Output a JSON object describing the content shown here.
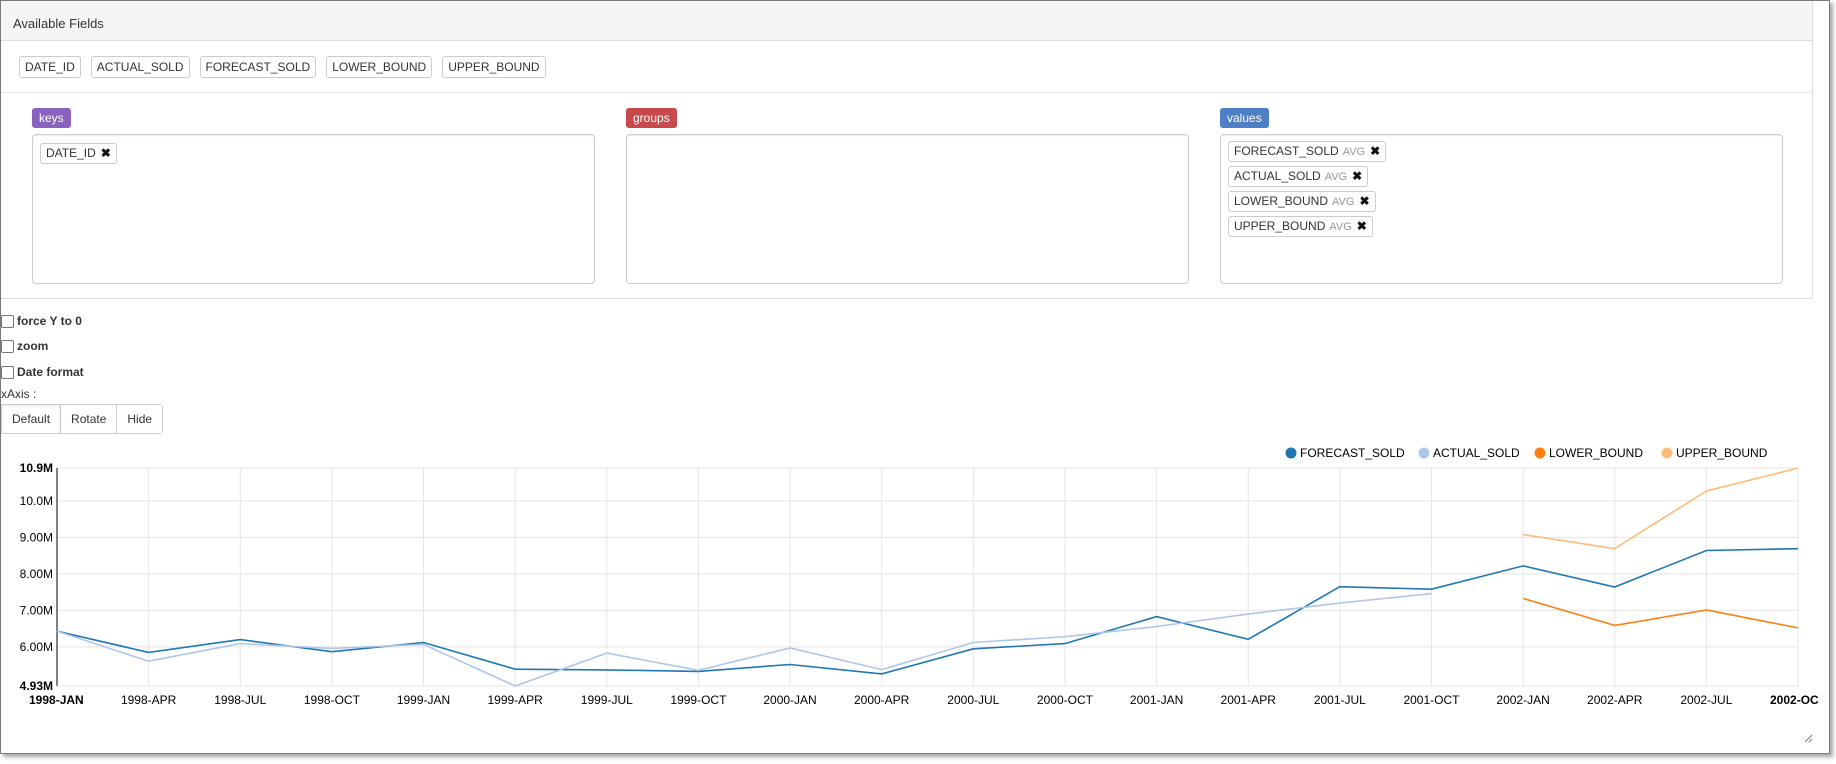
{
  "panel": {
    "heading": "Available Fields"
  },
  "available_fields": [
    "DATE_ID",
    "ACTUAL_SOLD",
    "FORECAST_SOLD",
    "LOWER_BOUND",
    "UPPER_BOUND"
  ],
  "keys": {
    "label": "keys",
    "color": "#8a63c0",
    "items": [
      {
        "name": "DATE_ID"
      }
    ]
  },
  "groups": {
    "label": "groups",
    "color": "#c9484b",
    "items": []
  },
  "values": {
    "label": "values",
    "color": "#4d7fc4",
    "items": [
      {
        "name": "FORECAST_SOLD",
        "agg": "AVG"
      },
      {
        "name": "ACTUAL_SOLD",
        "agg": "AVG"
      },
      {
        "name": "LOWER_BOUND",
        "agg": "AVG"
      },
      {
        "name": "UPPER_BOUND",
        "agg": "AVG"
      }
    ]
  },
  "options": {
    "force_y0": "force Y to 0",
    "zoom": "zoom",
    "date_format": "Date format"
  },
  "xaxis": {
    "label": "xAxis :",
    "buttons": [
      "Default",
      "Rotate",
      "Hide"
    ],
    "selected": "Default"
  },
  "chart_data": {
    "type": "line",
    "categories": [
      "1998-JAN",
      "1998-APR",
      "1998-JUL",
      "1998-OCT",
      "1999-JAN",
      "1999-APR",
      "1999-JUL",
      "1999-OCT",
      "2000-JAN",
      "2000-APR",
      "2000-JUL",
      "2000-OCT",
      "2001-JAN",
      "2001-APR",
      "2001-JUL",
      "2001-OCT",
      "2002-JAN",
      "2002-APR",
      "2002-JUL",
      "2002-OC"
    ],
    "series": [
      {
        "name": "FORECAST_SOLD",
        "color": "#1f77b4",
        "values": [
          6.43,
          5.85,
          6.2,
          5.87,
          6.12,
          5.39,
          5.37,
          5.33,
          5.52,
          5.26,
          5.95,
          6.09,
          6.83,
          6.21,
          7.65,
          7.58,
          8.22,
          7.64,
          8.64,
          8.69
        ]
      },
      {
        "name": "ACTUAL_SOLD",
        "color": "#aec7e8",
        "values": [
          6.43,
          5.61,
          6.09,
          5.96,
          6.07,
          4.93,
          5.83,
          5.36,
          5.97,
          5.38,
          6.12,
          6.28,
          6.56,
          6.9,
          7.2,
          7.46,
          null,
          null,
          null,
          null
        ]
      },
      {
        "name": "LOWER_BOUND",
        "color": "#ff7f0e",
        "values": [
          null,
          null,
          null,
          null,
          null,
          null,
          null,
          null,
          null,
          null,
          null,
          null,
          null,
          null,
          null,
          null,
          7.33,
          6.59,
          7.01,
          6.52
        ]
      },
      {
        "name": "UPPER_BOUND",
        "color": "#ffbb78",
        "values": [
          null,
          null,
          null,
          null,
          null,
          null,
          null,
          null,
          null,
          null,
          null,
          null,
          null,
          null,
          null,
          null,
          9.08,
          8.69,
          10.27,
          10.9
        ]
      }
    ],
    "ylim": [
      4.93,
      10.9
    ],
    "yticks": [
      {
        "v": 10.9,
        "label": "10.9M",
        "bold": true
      },
      {
        "v": 10.0,
        "label": "10.0M"
      },
      {
        "v": 9.0,
        "label": "9.00M"
      },
      {
        "v": 8.0,
        "label": "8.00M"
      },
      {
        "v": 7.0,
        "label": "7.00M"
      },
      {
        "v": 6.0,
        "label": "6.00M"
      },
      {
        "v": 4.93,
        "label": "4.93M",
        "bold": true
      }
    ],
    "grid": true,
    "legend_position": "top-right",
    "xlabel": "",
    "ylabel": "",
    "title": ""
  }
}
